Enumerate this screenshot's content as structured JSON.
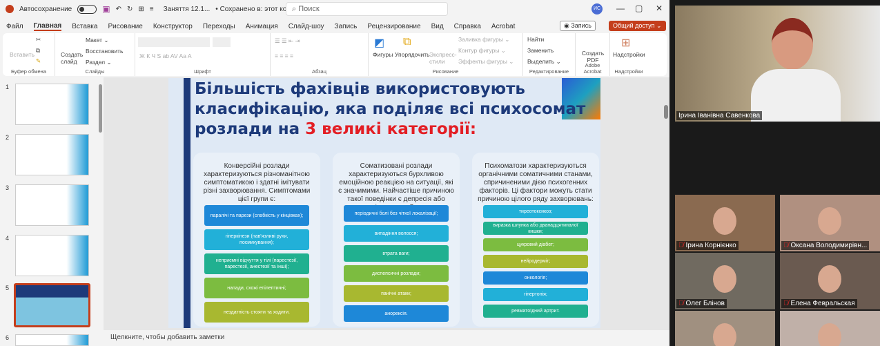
{
  "titlebar": {
    "autosave": "Автосохранение",
    "doc": "Заняття 12.1...",
    "saved": "• Сохранено в: этот компьютер ⌄",
    "search_placeholder": "Поиск",
    "avatar": "ИС"
  },
  "tabs": [
    "Файл",
    "Главная",
    "Вставка",
    "Рисование",
    "Конструктор",
    "Переходы",
    "Анимация",
    "Слайд-шоу",
    "Запись",
    "Рецензирование",
    "Вид",
    "Справка",
    "Acrobat"
  ],
  "rec": "◉ Запись",
  "share": "Общий доступ ⌄",
  "ribbon": {
    "paste": "Вставить",
    "clipboard": "Буфер обмена",
    "new_slide": "Создать слайд",
    "layout": "Макет ⌄",
    "reset": "Восстановить",
    "section": "Раздел ⌄",
    "slides": "Слайды",
    "font": "Шрифт",
    "font_btns": "Ж  К  Ч  S  ab  AV  Aa  A",
    "paragraph": "Абзац",
    "shapes": "Фигуры",
    "arrange": "Упорядочить",
    "quick_styles": "Экспресс-стили",
    "fill": "Заливка фигуры ⌄",
    "outline": "Контур фигуры ⌄",
    "effects": "Эффекты фигуры ⌄",
    "drawing": "Рисование",
    "find": "Найти",
    "replace": "Заменить",
    "select": "Выделить ⌄",
    "editing": "Редактирование",
    "create_pdf": "Создать PDF",
    "adobe": "Adobe Acrobat",
    "addins": "Надстройки",
    "addins_grp": "Надстройки"
  },
  "thumbs": [
    "1",
    "2",
    "3",
    "4",
    "5",
    "6"
  ],
  "slide": {
    "title1": "Більшість фахівців використовують",
    "title2": "класифікацію, яка поділяє всі психосомат",
    "title3a": "розлади на ",
    "title3b": "3 великі категорії:",
    "columns": [
      {
        "text": "Конверсійні розлади характеризуються різноманітною симптоматикою і здатні імітувати різні захворювання. Симптомами цієї групи є:",
        "items": [
          "паралічі та парези (слабкість у кінцівках);",
          "гіперкінези (нав'язливі рухи, посмикування);",
          "неприємні відчуття у тілі (парестезії, парестезії, анестезії та інші);",
          "напади, схожі епілептичні;",
          "нездатність стояти та ходити."
        ]
      },
      {
        "text": "Соматизовані розлади характеризуються бурхливою емоційною реакцією на ситуації, які є значимими. Найчастіше причиною такої поведінки є депресія або тривожні розлади. Симптоми:",
        "items": [
          "періодичні болі без чіткої локалізації;",
          "випадіння волосся;",
          "втрата ваги;",
          "диспепсичні розлади;",
          "панічні атаки;",
          "анорексія."
        ]
      },
      {
        "text": "Психоматози характеризуються органічними соматичними станами, спричиненими дією психогенних факторів. Ці фактори можуть стати причиною цілого ряду захворювань:",
        "items": [
          "тиреотоксикоз;",
          "виразка шлунка або дванадцятипалої кишки;",
          "цукровий діабет;",
          "нейродерміт;",
          "онкологія;",
          "гіпертонія;",
          "ревматоїдний артрит."
        ]
      }
    ]
  },
  "notes": "Щелкните, чтобы добавить заметки",
  "zoom": {
    "speaker": "Ірина Іванівна Савенкова",
    "tiles": [
      "Ірина Корнієнко",
      "Оксана Володимирівн...",
      "Олег Блінов",
      "Елена Февральская",
      "",
      ""
    ]
  },
  "colors": {
    "accent": "#c43e1c",
    "title": "#1d3a7a",
    "red": "#e31e24"
  }
}
